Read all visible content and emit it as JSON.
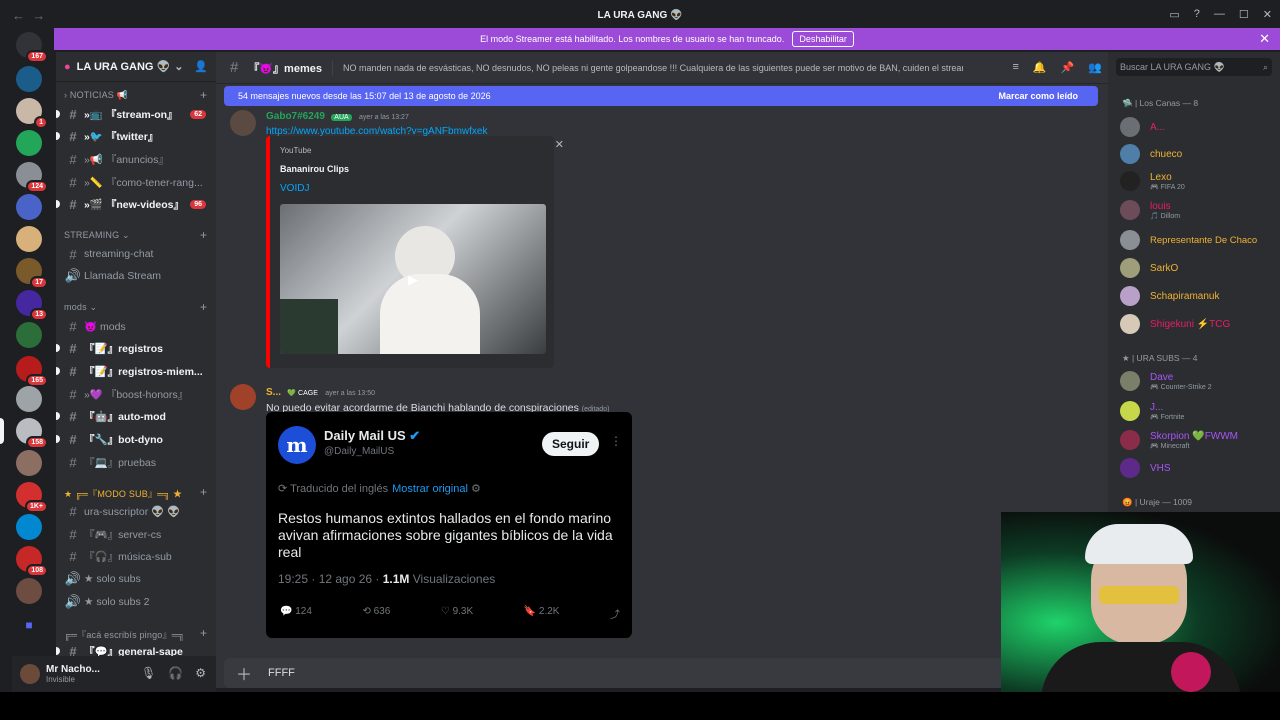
{
  "window": {
    "title": "LA URA GANG 👽"
  },
  "banner": {
    "text": "El modo Streamer está habilitado. Los nombres de usuario se han truncado.",
    "button": "Deshabilitar"
  },
  "guild_badges": [
    "167",
    "1",
    "124",
    "17",
    "13",
    "165",
    "158",
    "1K+",
    "108"
  ],
  "server": {
    "name": "LA URA GANG 👽"
  },
  "categories": {
    "noticias": "NOTICIAS 📢",
    "streaming": "STREAMING",
    "mods": "mods",
    "modo_sub": "★ ╔═『MODO SUB』═╗ ★",
    "aca": "╔═『acá escribís pingo』═╗"
  },
  "channels": [
    {
      "name": "»📺 『stream-on』",
      "badge": "62"
    },
    {
      "name": "»🐦 『twitter』",
      "badge": ""
    },
    {
      "name": "»📢 『anuncios』",
      "badge": ""
    },
    {
      "name": "»📏 『como-tener-rang...",
      "badge": ""
    },
    {
      "name": "»🎬 『new-videos』",
      "badge": "96"
    },
    {
      "name": "streaming-chat",
      "badge": ""
    },
    {
      "name": "Llamada Stream",
      "badge": ""
    },
    {
      "name": "😈 mods",
      "badge": ""
    },
    {
      "name": "『📝』registros",
      "badge": ""
    },
    {
      "name": "『📝』registros-miem...",
      "badge": ""
    },
    {
      "name": "»💜 『boost-honors』",
      "badge": ""
    },
    {
      "name": "『🤖』auto-mod",
      "badge": ""
    },
    {
      "name": "『🔧』bot-dyno",
      "badge": ""
    },
    {
      "name": "『💻』pruebas",
      "badge": ""
    },
    {
      "name": "ura-suscriptor 👽 👽",
      "badge": ""
    },
    {
      "name": "『🎮』server-cs",
      "badge": ""
    },
    {
      "name": "『🎧』música-sub",
      "badge": ""
    },
    {
      "name": "★ solo subs",
      "badge": ""
    },
    {
      "name": "★ solo subs 2",
      "badge": ""
    },
    {
      "name": "『💬』general-sape",
      "badge": ""
    }
  ],
  "user": {
    "name": "Mr Nacho...",
    "status": "Invisible"
  },
  "channel_header": {
    "name": "『😈』memes",
    "topic": "NO manden nada de esvásticas, NO desnudos, NO peleas ni gente golpeandose !!! Cualquiera de las siguientes puede ser motivo de BAN, cuiden el stream!"
  },
  "new_messages": {
    "text": "54 mensajes nuevos desde las 15:07 del 13 de agosto de 2026",
    "mark": "Marcar como leído"
  },
  "msg1": {
    "author": "Gabo7#6249",
    "tag": "AUA",
    "time": "ayer a las 13:27",
    "link": "https://www.youtube.com/watch?v=gANFbmwfxek",
    "embed": {
      "provider": "YouTube",
      "author": "Bananirou Clips",
      "title": "VOIDJ"
    }
  },
  "msg2": {
    "author": "S...",
    "tag": "CAGE",
    "time": "ayer a las 13:50",
    "text": "No puedo evitar acordarme de Bianchi hablando de conspiraciones",
    "edited": "(editado)"
  },
  "tweet": {
    "name": "Daily Mail US",
    "handle": "@Daily_MailUS",
    "follow": "Seguir",
    "translated": "Traducido del inglés",
    "show_original": "Mostrar original",
    "body": "Restos humanos extintos hallados en el fondo marino avivan afirmaciones sobre gigantes bíblicos de la vida real",
    "time": "19:25 · 12 ago 26 · ",
    "views": "1.1M",
    "views_label": " Visualizaciones",
    "replies": "124",
    "retweets": "636",
    "likes": "9.3K",
    "bookmarks": "2.2K"
  },
  "composer": {
    "value": "FFFF"
  },
  "search": {
    "placeholder": "Buscar LA URA GANG 👽"
  },
  "member_groups": {
    "canas": "🛸 | Los Canas — 8",
    "subs": "★ | URA SUBS — 4",
    "uraje": "😡 | Uraje — 1009"
  },
  "members": [
    {
      "name": "A...",
      "status": "",
      "color": "#e91e63"
    },
    {
      "name": "chueco",
      "status": "",
      "color": "#f0b232"
    },
    {
      "name": "Lexo",
      "status": "🎮 FIFA 20",
      "color": "#f0b232"
    },
    {
      "name": "louis",
      "status": "🎵 Dillom",
      "color": "#e91e63"
    },
    {
      "name": "Representante De Chaco",
      "status": "",
      "color": "#f0b232"
    },
    {
      "name": "SarkO",
      "status": "",
      "color": "#f0b232"
    },
    {
      "name": "Schapiramanuk",
      "status": "",
      "color": "#f0b232"
    },
    {
      "name": "Shigekuni ⚡TCG",
      "status": "",
      "color": "#e91e63"
    },
    {
      "name": "Dave",
      "status": "🎮 Counter-Strike 2",
      "color": "#a855f7"
    },
    {
      "name": "J...",
      "status": "🎮 Fortnite",
      "color": "#a855f7"
    },
    {
      "name": "Skorpion 💚FWWM",
      "status": "🎮 Minecraft",
      "color": "#a855f7"
    },
    {
      "name": "VHS",
      "status": "",
      "color": "#a855f7"
    }
  ]
}
